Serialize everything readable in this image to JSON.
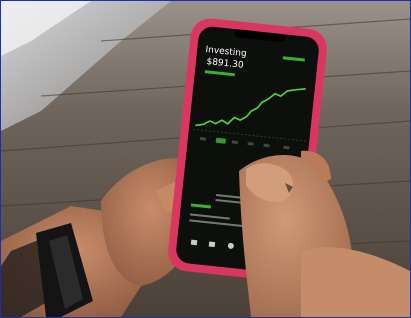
{
  "photo": {
    "description_free": true,
    "screen": {
      "app_title": "Investing",
      "balance": "$891.30",
      "colors": {
        "accent_green": "#4ddb3a",
        "case_pink": "#d93760",
        "screen_bg": "#0c0f0c",
        "table_wood": "#6b5e52"
      }
    }
  }
}
